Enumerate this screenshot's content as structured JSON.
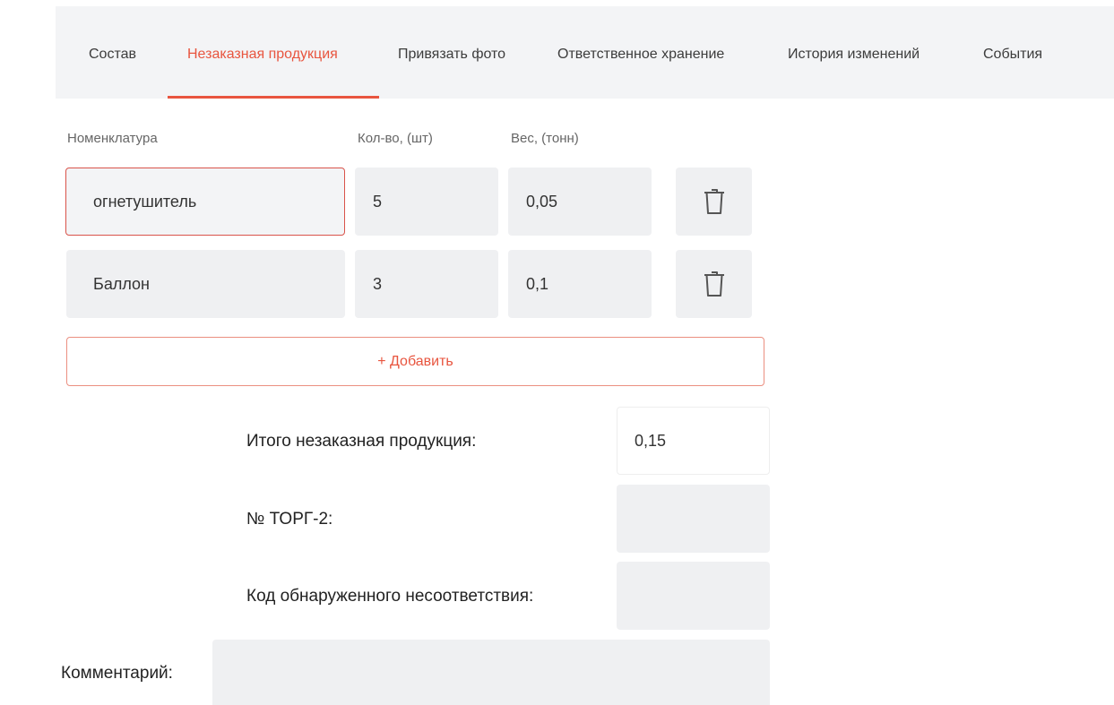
{
  "tabs": [
    {
      "label": "Состав"
    },
    {
      "label": "Незаказная продукция"
    },
    {
      "label": "Привязать фото"
    },
    {
      "label": "Ответственное хранение"
    },
    {
      "label": "История изменений"
    },
    {
      "label": "События"
    }
  ],
  "active_tab": "Незаказная продукция",
  "columns": {
    "name": "Номенклатура",
    "qty": "Кол-во, (шт)",
    "weight": "Вес, (тонн)"
  },
  "rows": [
    {
      "name": "огнетушитель",
      "qty": "5",
      "weight": "0,05"
    },
    {
      "name": "Баллон",
      "qty": "3",
      "weight": "0,1"
    }
  ],
  "add_button": "+ Добавить",
  "summary": {
    "total_label": "Итого незаказная продукция:",
    "total_value": "0,15",
    "torg_label": "№ ТОРГ-2:",
    "torg_value": "",
    "code_label": "Код обнаруженного несоответствия:",
    "code_value": "",
    "comment_label": "Комментарий:",
    "comment_value": ""
  },
  "icons": {
    "delete": "trash-icon"
  },
  "colors": {
    "accent": "#e8553f",
    "field_bg": "#eff0f2",
    "tabs_bg": "#f3f4f6"
  }
}
